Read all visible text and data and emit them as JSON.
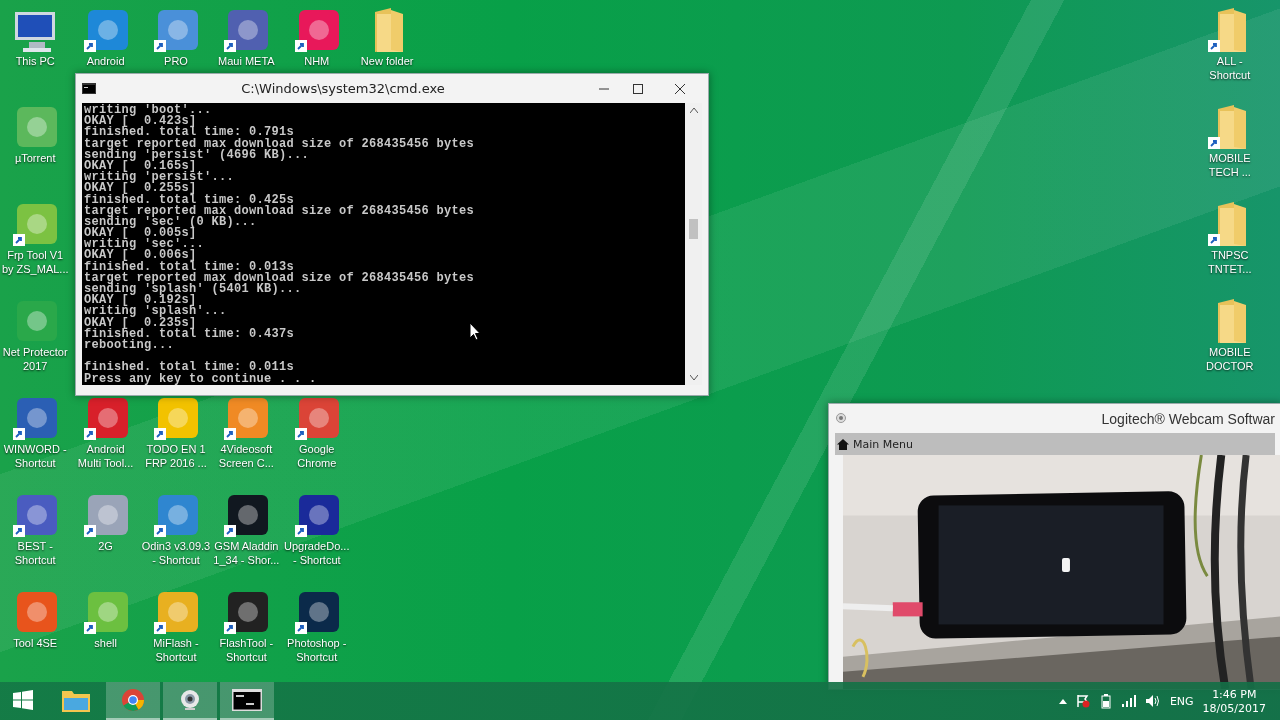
{
  "desktop": {
    "rows": [
      [
        {
          "kind": "computer",
          "lines": [
            "This PC"
          ],
          "shortcut": false
        },
        {
          "kind": "app",
          "color": "#1e88d8",
          "lines": [
            "Android"
          ],
          "shortcut": true
        },
        {
          "kind": "app",
          "color": "#4a90d9",
          "lines": [
            "PRO"
          ],
          "shortcut": true
        },
        {
          "kind": "app",
          "color": "#5060b0",
          "lines": [
            "Maui META"
          ],
          "shortcut": true
        },
        {
          "kind": "app",
          "color": "#e8185a",
          "lines": [
            "NHM"
          ],
          "shortcut": true
        },
        {
          "kind": "folder",
          "lines": [
            "New folder"
          ],
          "shortcut": false
        }
      ],
      [
        {
          "kind": "app",
          "color": "#5cb85c",
          "lines": [
            "µTorrent"
          ],
          "shortcut": false
        }
      ],
      [
        {
          "kind": "app",
          "color": "#7cc242",
          "lines": [
            "Frp Tool V1",
            "by ZS_MAL..."
          ],
          "shortcut": true
        }
      ],
      [
        {
          "kind": "app",
          "color": "#2aa84a",
          "lines": [
            "Net Protector",
            "2017"
          ],
          "shortcut": false
        }
      ],
      [
        {
          "kind": "app",
          "color": "#2b5fb4",
          "lines": [
            "WINWORD -",
            "Shortcut"
          ],
          "shortcut": true
        },
        {
          "kind": "app",
          "color": "#d8202a",
          "lines": [
            "Android",
            "Multi Tool..."
          ],
          "shortcut": true
        },
        {
          "kind": "app",
          "color": "#f2c200",
          "lines": [
            "TODO EN 1",
            "FRP 2016 ..."
          ],
          "shortcut": true
        },
        {
          "kind": "app",
          "color": "#f08a24",
          "lines": [
            "4Videosoft",
            "Screen C..."
          ],
          "shortcut": true
        },
        {
          "kind": "app",
          "color": "#db4437",
          "lines": [
            "Google",
            "Chrome"
          ],
          "shortcut": true
        }
      ],
      [
        {
          "kind": "app",
          "color": "#4a5cc0",
          "lines": [
            "BEST -",
            "Shortcut"
          ],
          "shortcut": true
        },
        {
          "kind": "app",
          "color": "#9aa4b8",
          "lines": [
            "2G"
          ],
          "shortcut": true
        },
        {
          "kind": "app",
          "color": "#2f86d0",
          "lines": [
            "Odin3 v3.09.3",
            "- Shortcut"
          ],
          "shortcut": true
        },
        {
          "kind": "app",
          "color": "#111820",
          "lines": [
            "GSM Aladdin",
            "1_34 - Shor..."
          ],
          "shortcut": true
        },
        {
          "kind": "app",
          "color": "#1a2a9a",
          "lines": [
            "UpgradeDo...",
            "- Shortcut"
          ],
          "shortcut": true
        }
      ],
      [
        {
          "kind": "app",
          "color": "#e8541c",
          "lines": [
            "Tool 4SE"
          ],
          "shortcut": false
        },
        {
          "kind": "app",
          "color": "#6cc040",
          "lines": [
            "shell"
          ],
          "shortcut": true
        },
        {
          "kind": "app",
          "color": "#e8b020",
          "lines": [
            "MiFlash -",
            "Shortcut"
          ],
          "shortcut": true
        },
        {
          "kind": "app",
          "color": "#222222",
          "lines": [
            "FlashTool -",
            "Shortcut"
          ],
          "shortcut": true
        },
        {
          "kind": "app",
          "color": "#0b2a4a",
          "lines": [
            "Photoshop -",
            "Shortcut"
          ],
          "shortcut": true
        }
      ]
    ],
    "right_column": [
      {
        "kind": "folder",
        "lines": [
          "ALL -",
          "Shortcut"
        ],
        "shortcut": true
      },
      {
        "kind": "folder",
        "lines": [
          "MOBILE",
          "TECH ..."
        ],
        "shortcut": true
      },
      {
        "kind": "folder",
        "lines": [
          "TNPSC",
          "TNTET..."
        ],
        "shortcut": true
      },
      {
        "kind": "folder",
        "lines": [
          "MOBILE",
          "DOCTOR"
        ],
        "shortcut": false
      }
    ]
  },
  "cmd_window": {
    "title": "C:\\Windows\\system32\\cmd.exe",
    "lines": [
      "writing 'boot'...",
      "OKAY [  0.423s]",
      "finished. total time: 0.791s",
      "target reported max download size of 268435456 bytes",
      "sending 'persist' (4696 KB)...",
      "OKAY [  0.165s]",
      "writing 'persist'...",
      "OKAY [  0.255s]",
      "finished. total time: 0.425s",
      "target reported max download size of 268435456 bytes",
      "sending 'sec' (0 KB)...",
      "OKAY [  0.005s]",
      "writing 'sec'...",
      "OKAY [  0.006s]",
      "finished. total time: 0.013s",
      "target reported max download size of 268435456 bytes",
      "sending 'splash' (5401 KB)...",
      "OKAY [  0.192s]",
      "writing 'splash'...",
      "OKAY [  0.235s]",
      "finished. total time: 0.437s",
      "rebooting..."
    ],
    "final_lines": [
      "finished. total time: 0.011s",
      "Press any key to continue . . ."
    ]
  },
  "webcam_window": {
    "title": "Logitech® Webcam Softwar",
    "menu": "Main Menu"
  },
  "taskbar": {
    "apps": [
      {
        "kind": "explorer",
        "open": false
      },
      {
        "kind": "chrome",
        "open": true
      },
      {
        "kind": "webcam",
        "open": true
      },
      {
        "kind": "console",
        "open": true
      }
    ],
    "language": "ENG",
    "time": "1:46 PM",
    "date": "18/05/2017"
  }
}
